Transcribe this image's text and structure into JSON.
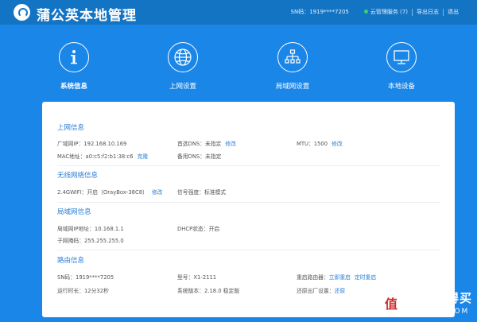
{
  "header": {
    "brand": "蒲公英本地管理",
    "sn": "SN码：1919****7205",
    "cloud_label": "云管理服务 (7)",
    "export_label": "导出日志",
    "logout_label": "退出",
    "status_color": "#3bd16f"
  },
  "nav": {
    "items": [
      {
        "label": "系统信息",
        "icon": "info-icon",
        "active": true
      },
      {
        "label": "上网设置",
        "icon": "globe-icon",
        "active": false
      },
      {
        "label": "局域网设置",
        "icon": "network-tree-icon",
        "active": false
      },
      {
        "label": "本地设备",
        "icon": "monitor-icon",
        "active": false
      }
    ]
  },
  "sections": {
    "internet": {
      "title": "上网信息",
      "wan_ip": "广域网IP：192.168.10.169",
      "mac": "MAC地址：a0:c5:f2:b1:38:c6",
      "clone": "克隆",
      "dns_primary": "首选DNS：未指定",
      "dns_primary_edit": "修改",
      "dns_backup": "备用DNS：未指定",
      "mtu": "MTU：1500",
      "mtu_edit": "修改"
    },
    "wireless": {
      "title": "无线网络信息",
      "wifi": "2.4GWIFI：开启（OrayBox-38C8）",
      "wifi_edit": "修改",
      "signal": "信号强度：标准模式"
    },
    "lan": {
      "title": "局域网信息",
      "lan_ip": "局域网IP地址：10.168.1.1",
      "mask": "子网掩码：255.255.255.0",
      "dhcp": "DHCP状态：开启"
    },
    "router": {
      "title": "路由信息",
      "sn": "SN码：1919****7205",
      "uptime": "运行时长：12分32秒",
      "model": "型号：X1-2111",
      "firmware": "系统版本：2.18.0 稳定版",
      "restart_label": "重启路由器：",
      "restart_now": "立即重启",
      "restart_timer": "定时重启",
      "factory_label": "还原出厂设置：",
      "factory_action": "还原"
    }
  },
  "watermark": {
    "badge": "值",
    "text_cn": "什么值得买",
    "text_en": "SMZDM.COM"
  }
}
